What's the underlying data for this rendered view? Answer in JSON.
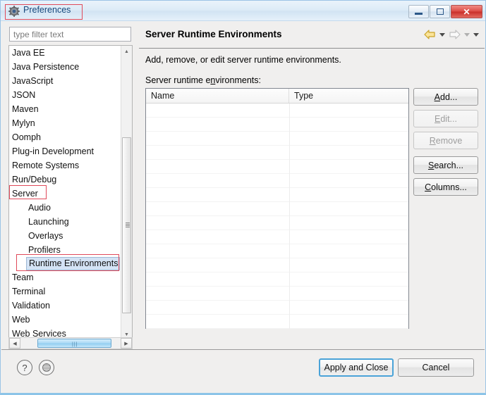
{
  "window": {
    "title": "Preferences",
    "icon": "preferences-gear-icon",
    "controls": {
      "minimize": "minimize-icon",
      "maximize": "maximize-icon",
      "close": "✕"
    }
  },
  "sidebar": {
    "filter": {
      "placeholder": "type filter text",
      "value": ""
    },
    "items": [
      {
        "label": "Java EE",
        "level": 1,
        "selected": false
      },
      {
        "label": "Java Persistence",
        "level": 1,
        "selected": false
      },
      {
        "label": "JavaScript",
        "level": 1,
        "selected": false
      },
      {
        "label": "JSON",
        "level": 1,
        "selected": false
      },
      {
        "label": "Maven",
        "level": 1,
        "selected": false
      },
      {
        "label": "Mylyn",
        "level": 1,
        "selected": false
      },
      {
        "label": "Oomph",
        "level": 1,
        "selected": false
      },
      {
        "label": "Plug-in Development",
        "level": 1,
        "selected": false
      },
      {
        "label": "Remote Systems",
        "level": 1,
        "selected": false
      },
      {
        "label": "Run/Debug",
        "level": 1,
        "selected": false
      },
      {
        "label": "Server",
        "level": 1,
        "selected": false
      },
      {
        "label": "Audio",
        "level": 2,
        "selected": false
      },
      {
        "label": "Launching",
        "level": 2,
        "selected": false
      },
      {
        "label": "Overlays",
        "level": 2,
        "selected": false
      },
      {
        "label": "Profilers",
        "level": 2,
        "selected": false
      },
      {
        "label": "Runtime Environments",
        "level": 2,
        "selected": true
      },
      {
        "label": "Team",
        "level": 1,
        "selected": false
      },
      {
        "label": "Terminal",
        "level": 1,
        "selected": false
      },
      {
        "label": "Validation",
        "level": 1,
        "selected": false
      },
      {
        "label": "Web",
        "level": 1,
        "selected": false
      },
      {
        "label": "Web Services",
        "level": 1,
        "selected": false
      }
    ]
  },
  "main": {
    "title": "Server Runtime Environments",
    "description": "Add, remove, or edit server runtime environments.",
    "sublabel_pre": "Server runtime e",
    "sublabel_mnemonic": "n",
    "sublabel_post": "vironments:",
    "nav": {
      "back": "back-arrow-icon",
      "forward": "forward-arrow-icon",
      "menu": "dropdown-caret-icon"
    },
    "table": {
      "columns": [
        "Name",
        "Type"
      ],
      "rows": []
    },
    "buttons": [
      {
        "pre": "",
        "mnemonic": "A",
        "post": "dd...",
        "label": "Add...",
        "enabled": true
      },
      {
        "pre": "",
        "mnemonic": "E",
        "post": "dit...",
        "label": "Edit...",
        "enabled": false
      },
      {
        "pre": "",
        "mnemonic": "R",
        "post": "emove",
        "label": "Remove",
        "enabled": false
      },
      {
        "pre": "",
        "mnemonic": "S",
        "post": "earch...",
        "label": "Search...",
        "enabled": true
      },
      {
        "pre": "",
        "mnemonic": "C",
        "post": "olumns...",
        "label": "Columns...",
        "enabled": true
      }
    ]
  },
  "footer": {
    "help_icon": "?",
    "oomph_icon": "record-preferences-icon",
    "apply_label": "Apply and Close",
    "cancel_label": "Cancel"
  },
  "colors": {
    "accent": "#4aa3d8",
    "annotation": "#e04a5a",
    "selection": "#d4e3f5",
    "title_text": "#16477b"
  }
}
